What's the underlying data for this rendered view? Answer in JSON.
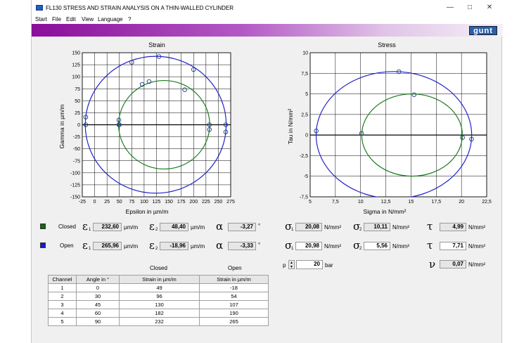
{
  "window": {
    "title": "FL130 STRESS AND STRAIN ANALYSIS ON A THIN-WALLED CYLINDER",
    "minimize": "—",
    "maximize": "□",
    "close": "✕",
    "logo": "gunt"
  },
  "menu": [
    "Start",
    "File",
    "Edit",
    "View",
    "Language",
    "?"
  ],
  "strain_chart": {
    "title": "Strain",
    "xlabel": "Epsilon in µm/m",
    "ylabel": "Gamma in µm/m",
    "xticks": [
      -25,
      0,
      25,
      50,
      75,
      100,
      125,
      150,
      175,
      200,
      225,
      250,
      275
    ],
    "yticks": [
      150,
      125,
      100,
      75,
      50,
      25,
      0,
      -25,
      -50,
      -75,
      -100,
      -125,
      -150
    ]
  },
  "stress_chart": {
    "title": "Stress",
    "xlabel": "Sigma in N/mm²",
    "ylabel": "Tau in N/mm²",
    "xticks": [
      "5",
      "7,5",
      "10",
      "12,5",
      "15",
      "17,5",
      "20",
      "22,5"
    ],
    "yticks": [
      "10",
      "7,5",
      "5",
      "2,5",
      "0",
      "-2,5",
      "-5",
      "-7,5"
    ]
  },
  "chart_data": [
    {
      "type": "scatter",
      "title": "Strain",
      "xlabel": "Epsilon in µm/m",
      "ylabel": "Gamma in µm/m",
      "xlim": [
        -25,
        275
      ],
      "ylim": [
        -150,
        150
      ],
      "grid": true,
      "series": [
        {
          "name": "Closed",
          "color": "#1a7a1a",
          "circle": {
            "center": [
              140.5,
              0
            ],
            "radius": 92.1
          },
          "x": [
            49,
            49,
            96,
            110,
            182,
            232,
            232
          ],
          "y": [
            0,
            10,
            84,
            90,
            73,
            0,
            -10
          ]
        },
        {
          "name": "Open",
          "color": "#2222cc",
          "circle": {
            "center": [
              123.5,
              0
            ],
            "radius": 142.5
          },
          "x": [
            -18,
            -18,
            50,
            75,
            130,
            200,
            265,
            265
          ],
          "y": [
            0,
            16,
            0,
            130,
            142,
            115,
            0,
            -15
          ]
        }
      ]
    },
    {
      "type": "scatter",
      "title": "Stress",
      "xlabel": "Sigma in N/mm²",
      "ylabel": "Tau in N/mm²",
      "xlim": [
        5,
        22.5
      ],
      "ylim": [
        -7.5,
        10
      ],
      "grid": true,
      "series": [
        {
          "name": "Closed",
          "color": "#1a7a1a",
          "circle": {
            "center": [
              15.1,
              0
            ],
            "radius": 4.99
          },
          "x": [
            10.1,
            15.3,
            20.1
          ],
          "y": [
            0.2,
            4.9,
            -0.3
          ]
        },
        {
          "name": "Open",
          "color": "#2222cc",
          "circle": {
            "center": [
              13.3,
              0
            ],
            "radius": 7.71
          },
          "x": [
            5.6,
            13.8,
            21
          ],
          "y": [
            0.5,
            7.7,
            -0.5
          ]
        }
      ]
    }
  ],
  "results": {
    "closed": {
      "label": "Closed",
      "color": "#116611",
      "eps1": "232,60",
      "eps1_unit": "µm/m",
      "eps2": "48,40",
      "eps2_unit": "µm/m",
      "alpha": "-3,27",
      "alpha_unit": "°",
      "sigma1": "20,08",
      "sigma1_unit": "N/mm²",
      "sigma2": "10,11",
      "sigma2_unit": "N/mm²",
      "tau": "4,99",
      "tau_unit": "N/mm²"
    },
    "open": {
      "label": "Open",
      "color": "#1a1acc",
      "eps1": "265,96",
      "eps1_unit": "µm/m",
      "eps2": "-18,96",
      "eps2_unit": "µm/m",
      "alpha": "-3,33",
      "alpha_unit": "°",
      "sigma1": "20,98",
      "sigma1_unit": "N/mm²",
      "sigma2": "5,56",
      "sigma2_unit": "N/mm²",
      "tau": "7,71",
      "tau_unit": "N/mm²"
    }
  },
  "symbols": {
    "eps": "ε",
    "alpha": "α",
    "sigma": "σ",
    "tau": "τ",
    "nu": "ν",
    "sub1": "1",
    "sub2": "2"
  },
  "pressure": {
    "label": "p",
    "value": "20",
    "unit": "bar"
  },
  "nu": {
    "value": "0,07",
    "unit": "N/mm²"
  },
  "table": {
    "group_headers": [
      "Closed",
      "Open"
    ],
    "headers": [
      "Channel",
      "Angle in °",
      "Strain in µm/m",
      "Strain in µm/m"
    ],
    "rows": [
      [
        "1",
        "0",
        "49",
        "-18"
      ],
      [
        "2",
        "30",
        "96",
        "54"
      ],
      [
        "3",
        "45",
        "130",
        "107"
      ],
      [
        "4",
        "60",
        "182",
        "190"
      ],
      [
        "5",
        "90",
        "232",
        "265"
      ]
    ]
  }
}
